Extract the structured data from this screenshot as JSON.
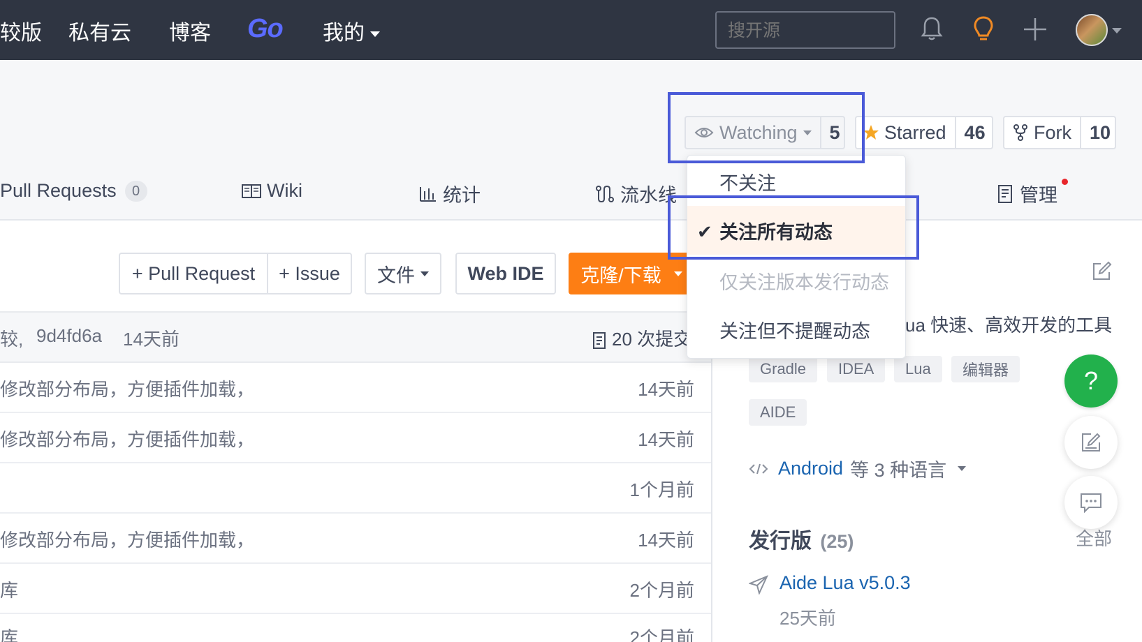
{
  "nav": {
    "items": [
      "较版",
      "私有云",
      "博客",
      "Go",
      "我的"
    ],
    "search_placeholder": "搜开源",
    "icons": [
      "bell-icon",
      "lightbulb-icon",
      "plus-icon",
      "avatar"
    ]
  },
  "repo_actions": {
    "watching_label": "Watching",
    "watching_count": "5",
    "starred_label": "Starred",
    "starred_count": "46",
    "fork_label": "Fork",
    "fork_count": "10"
  },
  "tabs": {
    "pull_requests": "Pull Requests",
    "pull_requests_count": "0",
    "wiki": "Wiki",
    "stats": "统计",
    "pipeline": "流水线",
    "manage": "管理"
  },
  "toolbar": {
    "pull_request": "+ Pull Request",
    "issue": "+ Issue",
    "files": "文件",
    "web_ide": "Web IDE",
    "clone": "克隆/下载"
  },
  "watch_dropdown": {
    "items": [
      {
        "label": "不关注",
        "state": "normal"
      },
      {
        "label": "关注所有动态",
        "state": "selected"
      },
      {
        "label": "仅关注版本发行动态",
        "state": "disabled"
      },
      {
        "label": "关注但不提醒动态",
        "state": "normal"
      }
    ]
  },
  "commit_bar": {
    "prefix": "较,",
    "hash": "9d4fd6a",
    "time": "14天前",
    "count": "20 次提交"
  },
  "file_rows": [
    {
      "message": "修改部分布局，方便插件加载，",
      "time": "14天前"
    },
    {
      "message": "修改部分布局，方便插件加载，",
      "time": "14天前"
    },
    {
      "message": "",
      "time": "1个月前"
    },
    {
      "message": "修改部分布局，方便插件加载，",
      "time": "14天前"
    },
    {
      "message": "库",
      "time": "2个月前"
    },
    {
      "message": "库",
      "time": "2个月前"
    }
  ],
  "sidebar": {
    "description": "ua 快速、高效开发的工具",
    "tags": [
      "Gradle",
      "IDEA",
      "Lua",
      "编辑器",
      "AIDE"
    ],
    "language_link": "Android",
    "language_suffix": "等 3 种语言",
    "releases_title": "发行版",
    "releases_count": "(25)",
    "all_link": "全部",
    "latest_release": "Aide Lua v5.0.3",
    "latest_release_time": "25天前"
  },
  "float_buttons": {
    "help": "?"
  },
  "colors": {
    "navbar": "#2f3542",
    "accent_orange": "#fd7e14",
    "highlight_box": "#4a5ad8",
    "help_green": "#22b14c",
    "link_blue": "#1a64b0"
  }
}
